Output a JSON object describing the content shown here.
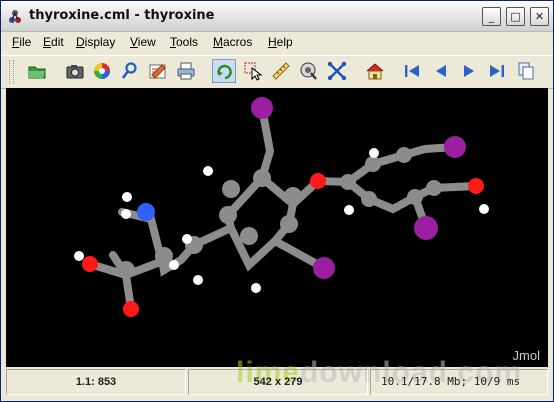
{
  "window": {
    "title": "thyroxine.cml - thyroxine",
    "controls": {
      "minimize": "_",
      "maximize": "□",
      "close": "✕"
    }
  },
  "menubar": {
    "items": [
      "File",
      "Edit",
      "Display",
      "View",
      "Tools",
      "Macros",
      "Help"
    ]
  },
  "toolbar": {
    "buttons": [
      {
        "name": "open-file-icon"
      },
      {
        "name": "camera-icon"
      },
      {
        "name": "color-spectrum-icon"
      },
      {
        "name": "script-icon"
      },
      {
        "name": "edit-icon"
      },
      {
        "name": "print-icon"
      },
      {
        "name": "rotate-icon",
        "pressed": true
      },
      {
        "name": "pick-icon"
      },
      {
        "name": "measure-icon"
      },
      {
        "name": "spin-icon"
      },
      {
        "name": "molecule-icon"
      },
      {
        "name": "home-icon"
      },
      {
        "name": "first-frame-icon"
      },
      {
        "name": "previous-frame-icon"
      },
      {
        "name": "next-frame-icon"
      },
      {
        "name": "last-frame-icon"
      },
      {
        "name": "duplicate-icon"
      }
    ]
  },
  "viewer": {
    "watermark_left": "lime",
    "watermark_right": "download.com",
    "app_label": "Jmol"
  },
  "statusbar": {
    "atom_info": "1.1: 853",
    "dimensions": "542 x 279",
    "speed": "10.1/17.8 Mb;  10/9 ms"
  },
  "colors": {
    "carbon": "#8c8c8c",
    "iodine": "#9b1fa0",
    "oxygen": "#ff1a1a",
    "nitrogen": "#3060ff",
    "hydrogen": "#ffffff"
  }
}
